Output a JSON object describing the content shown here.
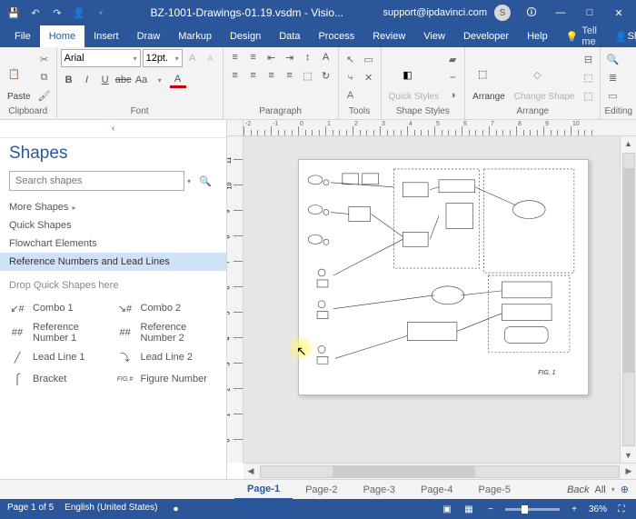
{
  "window": {
    "title": "BZ-1001-Drawings-01.19.vsdm - Visio...",
    "account_email": "support@ipdavinci.com",
    "user_initial": "S",
    "minimize": "—",
    "maximize": "□",
    "close": "✕"
  },
  "qat": {
    "save_icon": "💾",
    "undo_icon": "↶",
    "redo_icon": "↷",
    "user_icon": "👤",
    "more": "▾"
  },
  "tabs": {
    "file": "File",
    "home": "Home",
    "insert": "Insert",
    "draw": "Draw",
    "markup": "Markup",
    "design": "Design",
    "data": "Data",
    "process": "Process",
    "review": "Review",
    "view": "View",
    "developer": "Developer",
    "help": "Help",
    "tellme": "Tell me",
    "share": "Share",
    "collapse": "ᐱ"
  },
  "ribbon": {
    "clipboard": {
      "label": "Clipboard",
      "paste": "Paste"
    },
    "font": {
      "label": "Font",
      "name": "Arial",
      "size": "12pt.",
      "bold": "B",
      "italic": "I",
      "underline": "U",
      "strike": "abc",
      "case": "Aa",
      "more": "▾"
    },
    "paragraph": {
      "label": "Paragraph"
    },
    "tools": {
      "label": "Tools"
    },
    "shapestyles": {
      "label": "Shape Styles",
      "quick": "Quick Styles"
    },
    "arrange": {
      "label": "Arrange",
      "btn": "Arrange"
    },
    "change": {
      "btn": "Change Shape"
    },
    "editing": {
      "label": "Editing"
    }
  },
  "shapes": {
    "title": "Shapes",
    "search_placeholder": "Search shapes",
    "more": "More Shapes",
    "quick": "Quick Shapes",
    "flowchart": "Flowchart Elements",
    "refnum": "Reference Numbers and Lead Lines",
    "drop_msg": "Drop Quick Shapes here",
    "items": [
      "Combo 1",
      "Combo 2",
      "Reference Number 1",
      "Reference Number 2",
      "Lead Line 1",
      "Lead Line 2",
      "Bracket",
      "Figure Number"
    ]
  },
  "canvas": {
    "fig_caption": "FIG. 1"
  },
  "page_tabs": {
    "pages": [
      "Page-1",
      "Page-2",
      "Page-3",
      "Page-4",
      "Page-5"
    ],
    "back": "Back",
    "all": "All",
    "add": "⊕"
  },
  "statusbar": {
    "page": "Page 1 of 5",
    "lang": "English (United States)",
    "rec": "⏺",
    "zoom": "36%",
    "minus": "−",
    "plus": "+",
    "fit": "⛶"
  }
}
